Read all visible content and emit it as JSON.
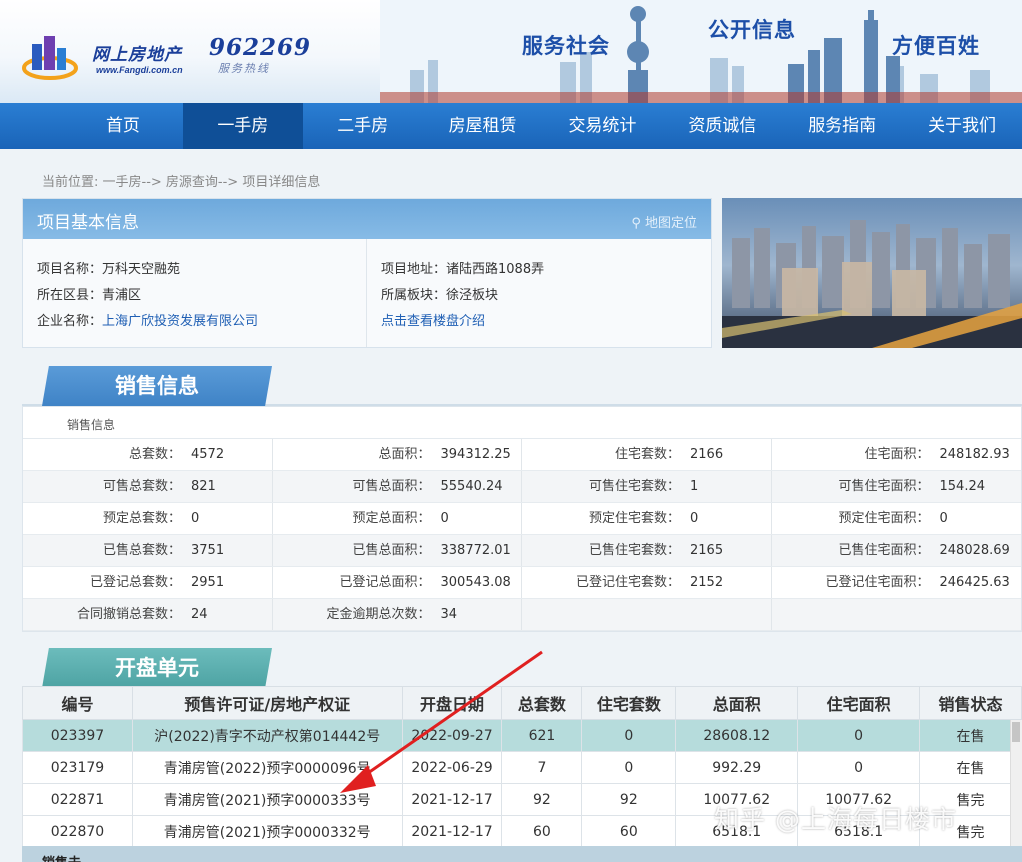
{
  "header": {
    "logo_text": "网上房地产",
    "logo_url": "www.Fangdi.com.cn",
    "hotline_number": "962269",
    "hotline_label": "服务热线",
    "slogans": [
      "服务社会",
      "公开信息",
      "方便百姓"
    ]
  },
  "nav": {
    "items": [
      "首页",
      "一手房",
      "二手房",
      "房屋租赁",
      "交易统计",
      "资质诚信",
      "服务指南",
      "关于我们"
    ],
    "active": "一手房"
  },
  "breadcrumb": "当前位置: 一手房--> 房源查询--> 项目详细信息",
  "project": {
    "panel_title": "项目基本信息",
    "map_link": "地图定位",
    "name_label": "项目名称：",
    "name": "万科天空融苑",
    "district_label": "所在区县：",
    "district": "青浦区",
    "company_label": "企业名称：",
    "company": "上海广欣投资发展有限公司",
    "address_label": "项目地址：",
    "address": "诸陆西路1088弄",
    "block_label": "所属板块：",
    "block": "徐泾板块",
    "intro_link": "点击查看楼盘介绍"
  },
  "sales_section": {
    "title": "销售信息",
    "sub_label": "销售信息",
    "rows": [
      [
        [
          "总套数：",
          "4572"
        ],
        [
          "总面积：",
          "394312.25"
        ],
        [
          "住宅套数：",
          "2166"
        ],
        [
          "住宅面积：",
          "248182.93"
        ]
      ],
      [
        [
          "可售总套数：",
          "821"
        ],
        [
          "可售总面积：",
          "55540.24"
        ],
        [
          "可售住宅套数：",
          "1"
        ],
        [
          "可售住宅面积：",
          "154.24"
        ]
      ],
      [
        [
          "预定总套数：",
          "0"
        ],
        [
          "预定总面积：",
          "0"
        ],
        [
          "预定住宅套数：",
          "0"
        ],
        [
          "预定住宅面积：",
          "0"
        ]
      ],
      [
        [
          "已售总套数：",
          "3751"
        ],
        [
          "已售总面积：",
          "338772.01"
        ],
        [
          "已售住宅套数：",
          "2165"
        ],
        [
          "已售住宅面积：",
          "248028.69"
        ]
      ],
      [
        [
          "已登记总套数：",
          "2951"
        ],
        [
          "已登记总面积：",
          "300543.08"
        ],
        [
          "已登记住宅套数：",
          "2152"
        ],
        [
          "已登记住宅面积：",
          "246425.63"
        ]
      ],
      [
        [
          "合同撤销总套数：",
          "24"
        ],
        [
          "定金逾期总次数：",
          "34"
        ],
        [
          "",
          ""
        ],
        [
          "",
          ""
        ]
      ]
    ]
  },
  "open_section": {
    "title": "开盘单元",
    "headers": [
      "编号",
      "预售许可证/房地产权证",
      "开盘日期",
      "总套数",
      "住宅套数",
      "总面积",
      "住宅面积",
      "销售状态"
    ],
    "rows": [
      [
        "023397",
        "沪(2022)青字不动产权第014442号",
        "2022-09-27",
        "621",
        "0",
        "28608.12",
        "0",
        "在售"
      ],
      [
        "023179",
        "青浦房管(2022)预字0000096号",
        "2022-06-29",
        "7",
        "0",
        "992.29",
        "0",
        "在售"
      ],
      [
        "022871",
        "青浦房管(2021)预字0000333号",
        "2021-12-17",
        "92",
        "92",
        "10077.62",
        "10077.62",
        "售完"
      ],
      [
        "022870",
        "青浦房管(2021)预字0000332号",
        "2021-12-17",
        "60",
        "60",
        "6518.1",
        "6518.1",
        "售完"
      ]
    ]
  },
  "bottom_label": "销售去",
  "watermark": "知乎 @上海每日楼市",
  "colors": {
    "nav_blue": "#1a64b8",
    "nav_active": "#0f4f97",
    "sales_tab": "#4a8fcf",
    "open_tab": "#5cb0b0",
    "status_on": "#1a8a1a",
    "status_off": "#d42020",
    "annotation_arrow": "#e02020"
  }
}
